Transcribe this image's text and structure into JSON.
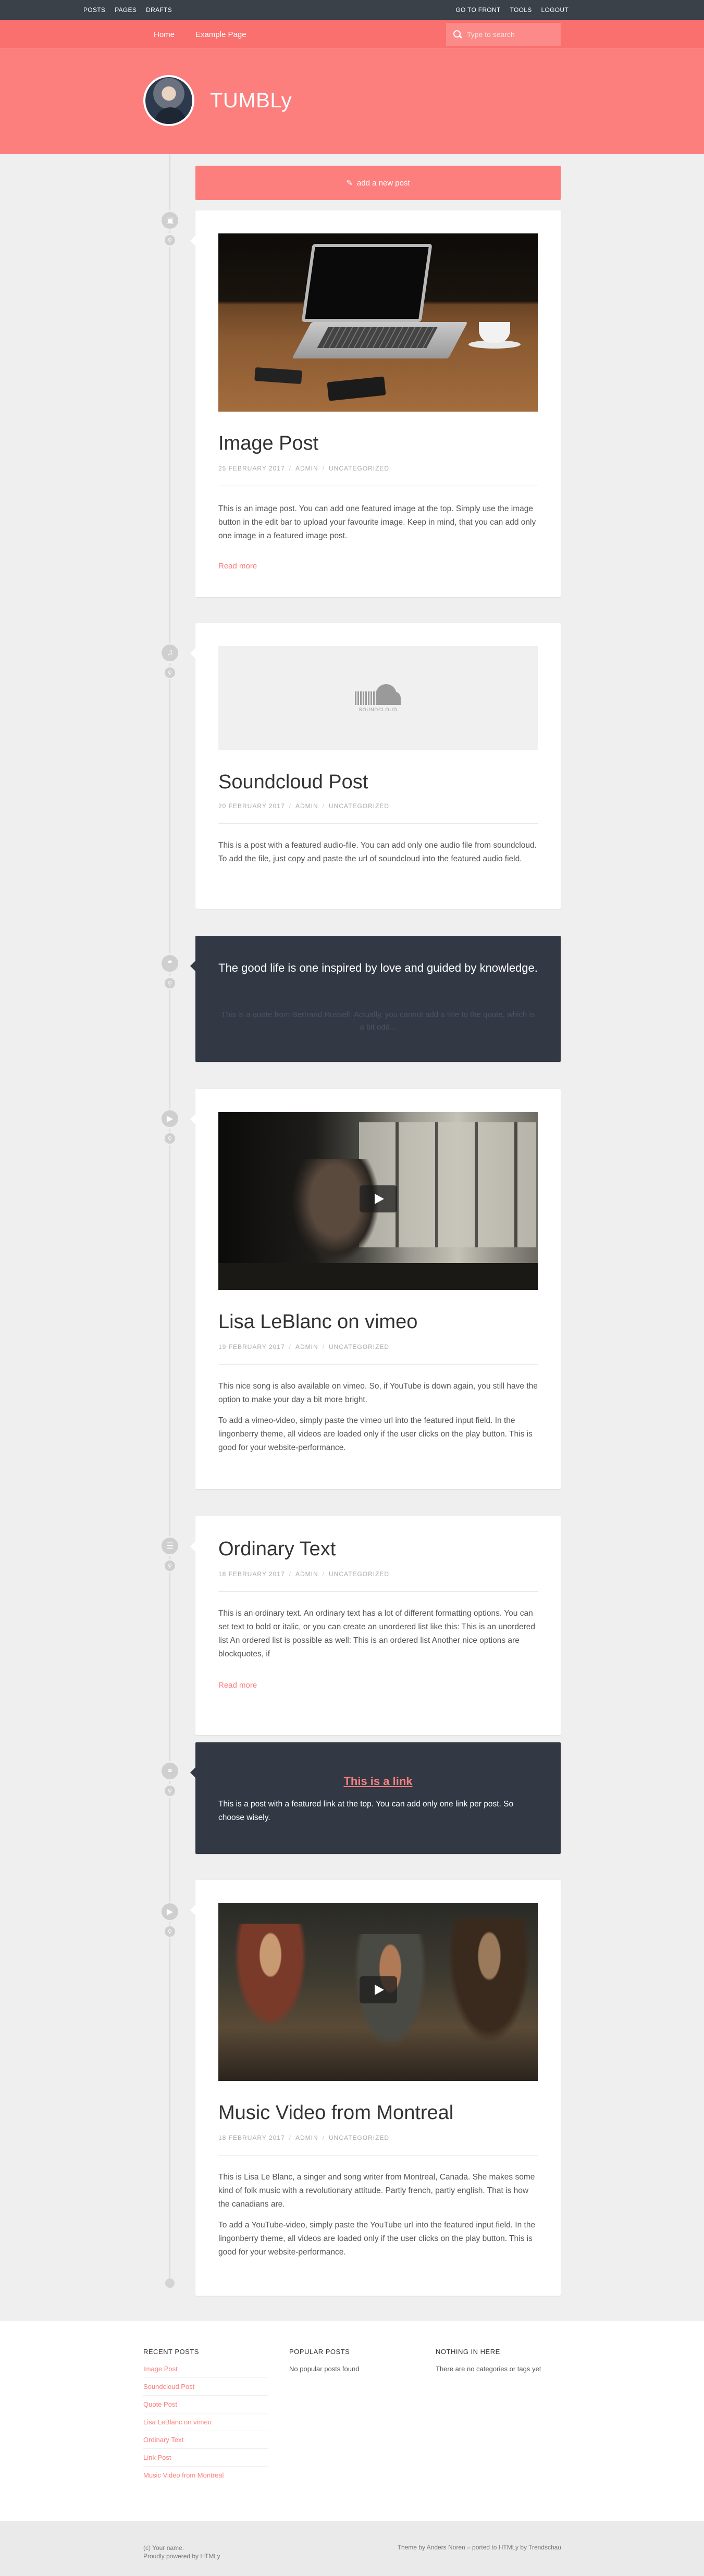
{
  "adminbar": {
    "left": [
      "POSTS",
      "PAGES",
      "DRAFTS"
    ],
    "right": [
      "GO TO FRONT",
      "TOOLS",
      "LOGOUT"
    ]
  },
  "nav": {
    "links": [
      "Home",
      "Example Page"
    ],
    "search_placeholder": "Type to search"
  },
  "site": {
    "title": "TUMBLy"
  },
  "add_post": {
    "label": "add a new post",
    "icon": "pencil-icon"
  },
  "posts": [
    {
      "type": "image",
      "title": "Image Post",
      "date": "25 FEBRUARY 2017",
      "author": "ADMIN",
      "category": "UNCATEGORIZED",
      "excerpt": "This is an image post. You can add one featured image at the top. Simply use the image button in the edit bar to upload your favourite image. Keep in mind, that you can add only one image in a featured image post.",
      "read_more": "Read more",
      "icon": "camera-icon"
    },
    {
      "type": "audio",
      "title": "Soundcloud Post",
      "date": "20 FEBRUARY 2017",
      "author": "ADMIN",
      "category": "UNCATEGORIZED",
      "media_label": "SOUNDCLOUD",
      "excerpt": "This is a post with a featured audio-file. You can add only one audio file from soundcloud. To add the file, just copy and paste the url of soundcloud into the featured audio field.",
      "icon": "music-icon"
    },
    {
      "type": "quote",
      "quote": "The good life is one inspired by love and guided by knowledge.",
      "source": "This is a quote from Bertrand Russell. Actually, you cannot add a title to the quote, which is a bit odd...",
      "icon": "quote-icon"
    },
    {
      "type": "video",
      "title": "Lisa LeBlanc on vimeo",
      "date": "19 FEBRUARY 2017",
      "author": "ADMIN",
      "category": "UNCATEGORIZED",
      "excerpt1": "This nice song is also available on vimeo. So, if YouTube is down again, you still have the option to make your day a bit more bright.",
      "excerpt2": "To add a vimeo-video, simply paste the vimeo url into the featured input field. In the lingonberry theme, all videos are loaded only if the user clicks on the play button. This is good for your website-performance.",
      "icon": "video-icon"
    },
    {
      "type": "standard",
      "title": "Ordinary Text",
      "date": "18 FEBRUARY 2017",
      "author": "ADMIN",
      "category": "UNCATEGORIZED",
      "excerpt": "This is an ordinary text. An ordinary text has a lot of different formatting options. You can set text to bold or italic, or you can create an unordered list like this: This is an unordered list An ordered list is possible as well: This is an ordered list Another nice options are blockquotes, if",
      "read_more": "Read more",
      "icon": "document-icon"
    },
    {
      "type": "link",
      "link_title": "This is a link",
      "text": "This is a post with a featured link at the top. You can add only one link per post. So choose wisely.",
      "icon": "link-icon"
    },
    {
      "type": "video",
      "title": "Music Video from Montreal",
      "date": "18 FEBRUARY 2017",
      "author": "ADMIN",
      "category": "UNCATEGORIZED",
      "excerpt1": "This is Lisa Le Blanc, a singer and song writer from Montreal, Canada. She makes some kind of folk music with a revolutionary attitude. Partly french, partly english. That is how the canadians are.",
      "excerpt2": "To add a YouTube-video, simply paste the YouTube url into the featured input field. In the lingonberry theme, all videos are loaded only if the user clicks on the play button. This is good for your website-performance.",
      "icon": "video-icon"
    }
  ],
  "footer": {
    "recent_title": "RECENT POSTS",
    "recent": [
      "Image Post",
      "Soundcloud Post",
      "Quote Post",
      "Lisa LeBlanc on vimeo",
      "Ordinary Text",
      "Link Post",
      "Music Video from Montreal"
    ],
    "popular_title": "POPULAR POSTS",
    "popular_text": "No popular posts found",
    "nothing_title": "NOTHING IN HERE",
    "nothing_text": "There are no categories or tags yet",
    "credit_left_1": "(c) Your name.",
    "credit_left_2": "Proudly powered by HTMLy",
    "credit_right": "Theme by Anders Noren – ported to HTMLy by Trendschau"
  },
  "colors": {
    "accent": "#fc7f7d",
    "dark_card": "#323945",
    "adminbar": "#3a4148"
  }
}
